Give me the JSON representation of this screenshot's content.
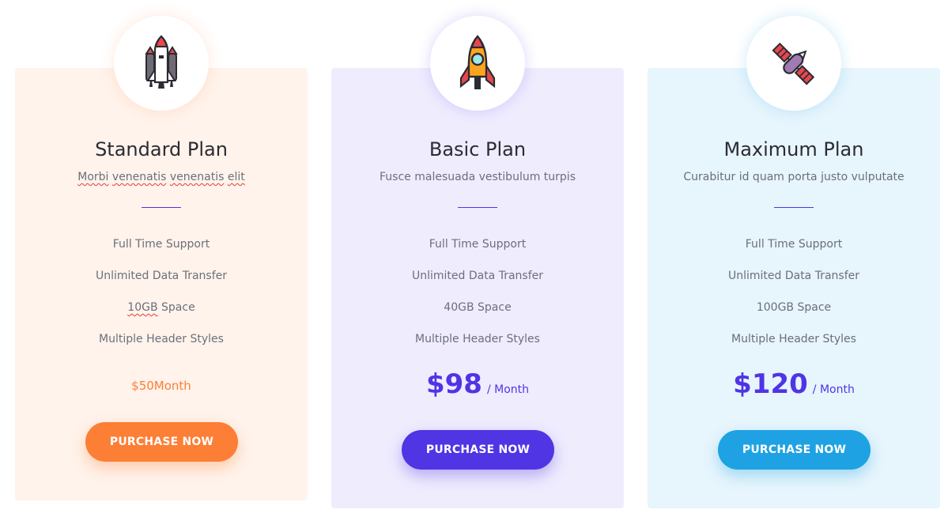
{
  "colors": {
    "orange": "#fd7e35",
    "purple": "#4f35e4",
    "blue": "#1ea2e3",
    "card_bg_1": "#fff3eb",
    "card_bg_2": "#efecfe",
    "card_bg_3": "#e7f5fd"
  },
  "plans": [
    {
      "icon": "space-shuttle-icon",
      "title": "Standard Plan",
      "description_words": [
        "Morbi",
        "venenatis",
        "venenatis",
        "elit"
      ],
      "features": [
        "Full Time Support",
        "Unlimited Data Transfer",
        "10GB",
        "Space",
        "Multiple Header Styles"
      ],
      "price": "$50Month",
      "button": "PURCHASE NOW"
    },
    {
      "icon": "rocket-icon",
      "title": "Basic Plan",
      "description": "Fusce malesuada vestibulum turpis",
      "features": [
        "Full Time Support",
        "Unlimited Data Transfer",
        "40GB Space",
        "Multiple Header Styles"
      ],
      "price_amount": "$98",
      "price_period": "/ Month",
      "button": "PURCHASE NOW"
    },
    {
      "icon": "satellite-icon",
      "title": "Maximum Plan",
      "description": "Curabitur id quam porta justo vulputate",
      "features": [
        "Full Time Support",
        "Unlimited Data Transfer",
        "100GB Space",
        "Multiple Header Styles"
      ],
      "price_amount": "$120",
      "price_period": "/ Month",
      "button": "PURCHASE NOW"
    }
  ]
}
